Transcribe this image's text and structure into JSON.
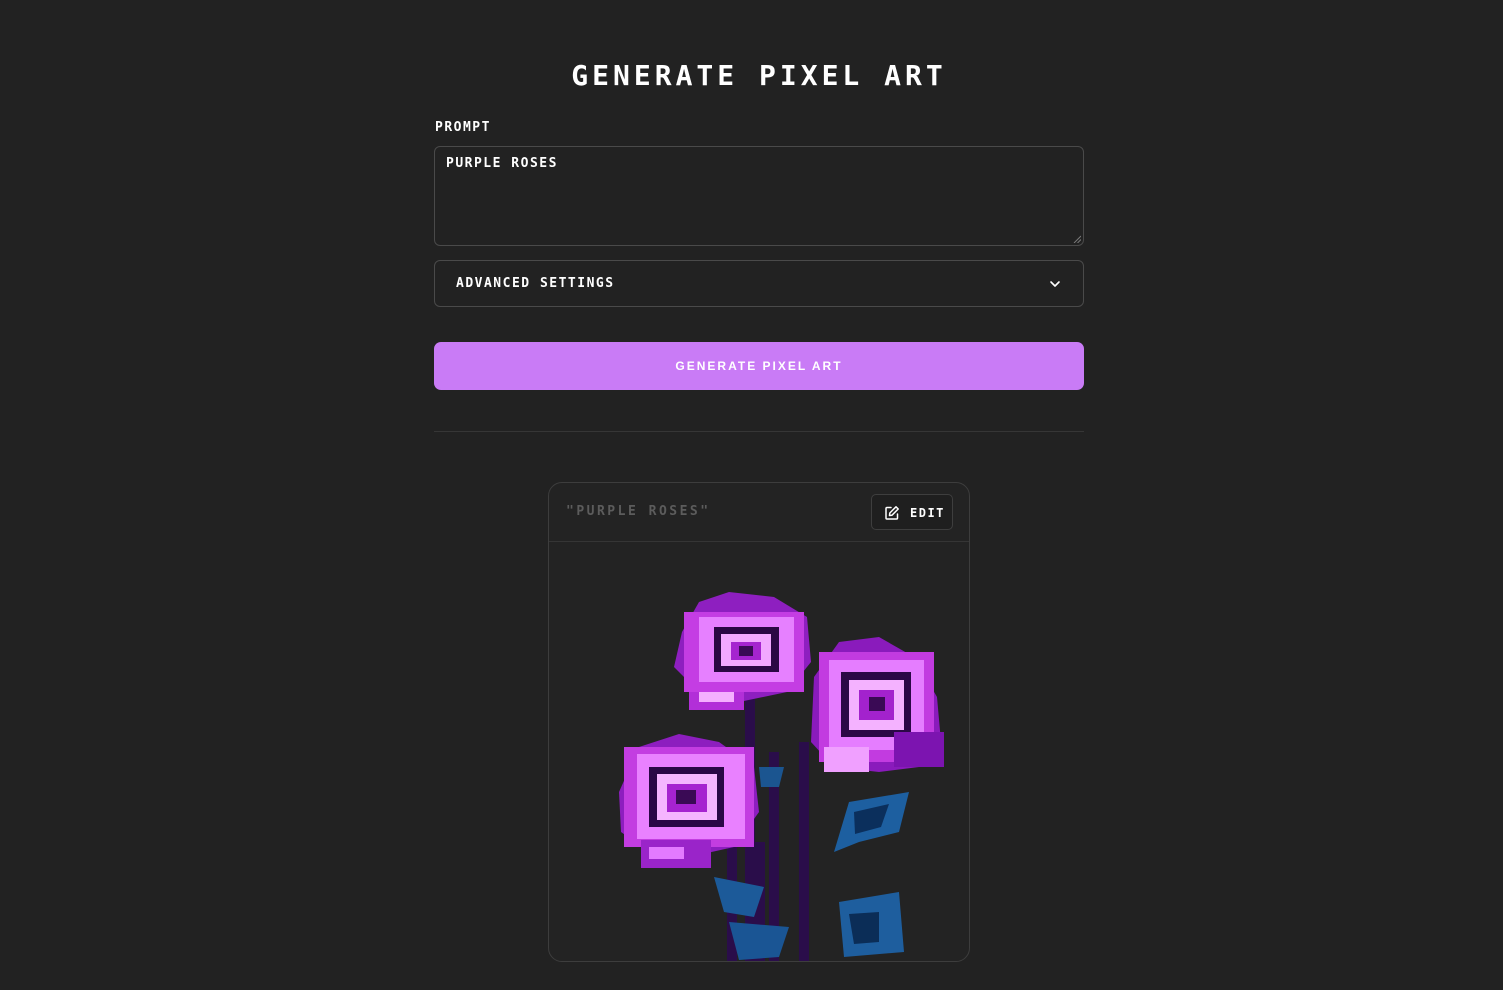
{
  "page": {
    "title": "GENERATE PIXEL ART"
  },
  "form": {
    "prompt_label": "PROMPT",
    "prompt_value": "PURPLE ROSES",
    "advanced_label": "ADVANCED SETTINGS",
    "advanced_icon": "chevron-down-icon",
    "generate_label": "GENERATE PIXEL ART"
  },
  "result": {
    "prompt_display": "\"PURPLE ROSES\"",
    "edit_label": "EDIT",
    "edit_icon": "edit-icon",
    "image_subject": "pixel-art-purple-roses"
  },
  "colors": {
    "background": "#222222",
    "accent": "#c97bf6",
    "border": "#4a4a4a",
    "muted_text": "#5c5c5c"
  }
}
